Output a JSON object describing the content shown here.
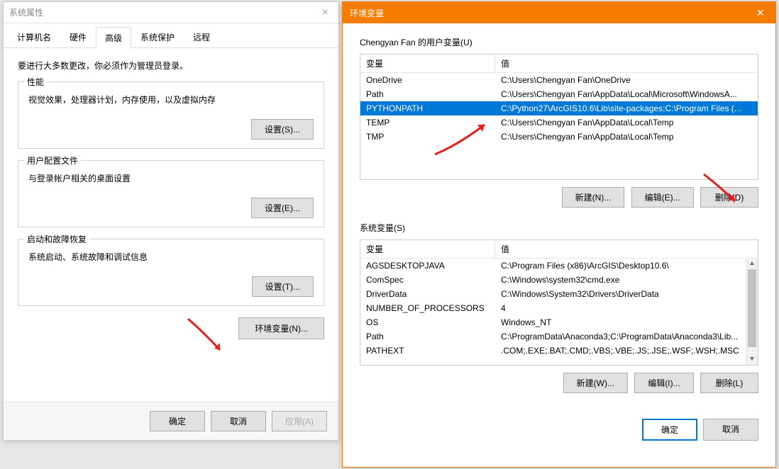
{
  "sysProps": {
    "title": "系统属性",
    "tabs": [
      "计算机名",
      "硬件",
      "高级",
      "系统保护",
      "远程"
    ],
    "activeTab": 2,
    "note": "要进行大多数更改，你必须作为管理员登录。",
    "groups": {
      "performance": {
        "title": "性能",
        "desc": "视觉效果，处理器计划，内存使用，以及虚拟内存",
        "button": "设置(S)..."
      },
      "profiles": {
        "title": "用户配置文件",
        "desc": "与登录帐户相关的桌面设置",
        "button": "设置(E)..."
      },
      "startup": {
        "title": "启动和故障恢复",
        "desc": "系统启动、系统故障和调试信息",
        "button": "设置(T)..."
      }
    },
    "envButton": "环境变量(N)...",
    "footer": {
      "ok": "确定",
      "cancel": "取消",
      "apply": "应用(A)"
    }
  },
  "envDialog": {
    "title": "环境变量",
    "userSection": "Chengyan Fan 的用户变量(U)",
    "sysSection": "系统变量(S)",
    "headers": {
      "name": "变量",
      "value": "值"
    },
    "userVars": [
      {
        "name": "OneDrive",
        "value": "C:\\Users\\Chengyan Fan\\OneDrive"
      },
      {
        "name": "Path",
        "value": "C:\\Users\\Chengyan Fan\\AppData\\Local\\Microsoft\\WindowsA..."
      },
      {
        "name": "PYTHONPATH",
        "value": "C:\\Python27\\ArcGIS10.6\\Lib\\site-packages;C:\\Program Files (..."
      },
      {
        "name": "TEMP",
        "value": "C:\\Users\\Chengyan Fan\\AppData\\Local\\Temp"
      },
      {
        "name": "TMP",
        "value": "C:\\Users\\Chengyan Fan\\AppData\\Local\\Temp"
      }
    ],
    "userSelected": 2,
    "sysVars": [
      {
        "name": "AGSDESKTOPJAVA",
        "value": "C:\\Program Files (x86)\\ArcGIS\\Desktop10.6\\"
      },
      {
        "name": "ComSpec",
        "value": "C:\\Windows\\system32\\cmd.exe"
      },
      {
        "name": "DriverData",
        "value": "C:\\Windows\\System32\\Drivers\\DriverData"
      },
      {
        "name": "NUMBER_OF_PROCESSORS",
        "value": "4"
      },
      {
        "name": "OS",
        "value": "Windows_NT"
      },
      {
        "name": "Path",
        "value": "C:\\ProgramData\\Anaconda3;C:\\ProgramData\\Anaconda3\\Lib..."
      },
      {
        "name": "PATHEXT",
        "value": ".COM;.EXE;.BAT;.CMD;.VBS;.VBE;.JS;.JSE;.WSF;.WSH;.MSC"
      }
    ],
    "buttons": {
      "newU": "新建(N)...",
      "editU": "编辑(E)...",
      "delU": "删除(D)",
      "newS": "新建(W)...",
      "editS": "编辑(I)...",
      "delS": "删除(L)",
      "ok": "确定",
      "cancel": "取消"
    }
  }
}
